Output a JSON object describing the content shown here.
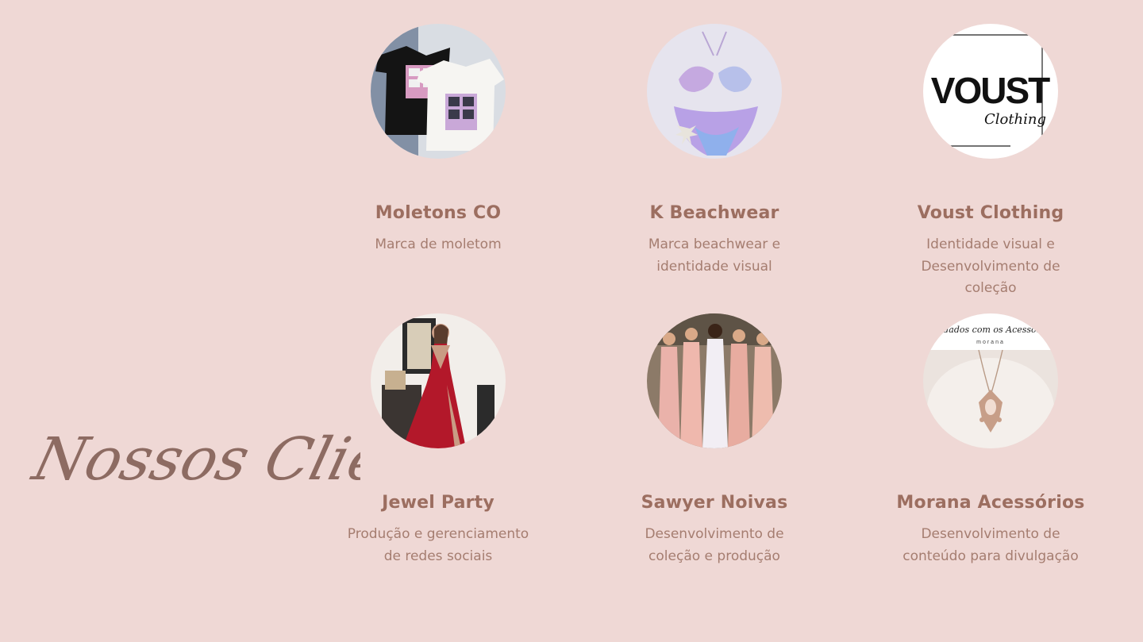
{
  "section": {
    "title": "Nossos Clientes"
  },
  "clients": [
    {
      "name": "Moletons CO",
      "description": "Marca de moletom",
      "icon": "tshirts-photo"
    },
    {
      "name": "K Beachwear",
      "description": "Marca beachwear e identidade visual",
      "icon": "bikini-photo"
    },
    {
      "name": "Voust Clothing",
      "description": "Identidade visual e Desenvolvimento de coleção",
      "icon": "voust-logo",
      "logo_text": "VOUST",
      "logo_script": "Clothing"
    },
    {
      "name": "Jewel Party",
      "description": "Produção e gerenciamento de redes sociais",
      "icon": "red-dress-photo"
    },
    {
      "name": "Sawyer Noivas",
      "description": "Desenvolvimento de coleção e produção",
      "icon": "bridesmaids-photo"
    },
    {
      "name": "Morana Acessórios",
      "description": "Desenvolvimento de conteúdo para divulgação",
      "icon": "necklace-photo",
      "logo_banner": "Cuidados com os Acessórios",
      "logo_brand": "morana"
    }
  ],
  "colors": {
    "background": "#efd8d5",
    "heading": "#9c6e60",
    "body": "#a57d70",
    "script": "#8d6b62"
  }
}
